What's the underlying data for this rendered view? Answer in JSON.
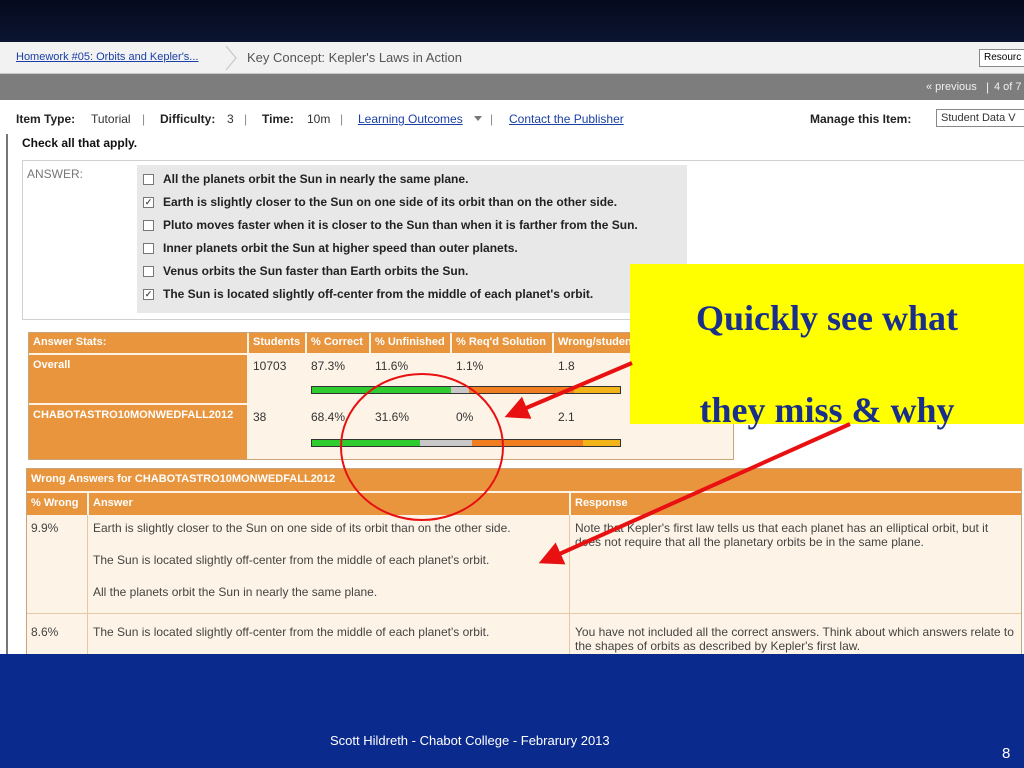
{
  "breadcrumb": {
    "link": "Homework #05: Orbits and Kepler's...",
    "current": "Key Concept: Kepler's Laws in Action"
  },
  "resources_select": "Resourc",
  "pager": {
    "previous": "« previous",
    "separator": "|",
    "count": "4 of 7"
  },
  "infobar": {
    "item_type_label": "Item Type:",
    "item_type_value": "Tutorial",
    "difficulty_label": "Difficulty:",
    "difficulty_value": "3",
    "time_label": "Time:",
    "time_value": "10m",
    "learning_outcomes": "Learning Outcomes",
    "contact": "Contact the Publisher",
    "manage_label": "Manage this Item:",
    "manage_value": "Student Data V",
    "separator": "|"
  },
  "question": {
    "instruction": "Check all that apply.",
    "answer_label": "ANSWER:",
    "options": [
      {
        "text": "All the planets orbit the Sun in nearly the same plane.",
        "checked": false,
        "mark": ""
      },
      {
        "text": "Earth is slightly closer to the Sun on one side of its orbit than on the other side.",
        "checked": true,
        "mark": "✓"
      },
      {
        "text": "Pluto moves faster when it is closer to the Sun than when it is farther from the Sun.",
        "checked": false,
        "mark": ""
      },
      {
        "text": "Inner planets orbit the Sun at higher speed than outer planets.",
        "checked": false,
        "mark": ""
      },
      {
        "text": "Venus orbits the Sun faster than Earth orbits the Sun.",
        "checked": false,
        "mark": ""
      },
      {
        "text": "The Sun is located slightly off-center from the middle of each planet's orbit.",
        "checked": true,
        "mark": "✓"
      }
    ]
  },
  "answer_stats": {
    "headers": [
      "Answer Stats:",
      "Students",
      "% Correct",
      "% Unfinished",
      "% Req'd Solution",
      "Wrong/studen"
    ],
    "rows": [
      {
        "label": "Overall",
        "students": "10703",
        "correct": "87.3%",
        "unfinished": "11.6%",
        "reqd": "1.1%",
        "wrong": "1.8",
        "bar": {
          "green": 0.45,
          "grey": 0.06,
          "orange": 0.34,
          "yellow": 0.15
        }
      },
      {
        "label": "CHABOTASTRO10MONWEDFALL2012",
        "students": "38",
        "correct": "68.4%",
        "unfinished": "31.6%",
        "reqd": "0%",
        "wrong": "2.1",
        "bar": {
          "green": 0.35,
          "grey": 0.17,
          "orange": 0.36,
          "yellow": 0.12
        }
      }
    ],
    "colors": {
      "green": "#2ecc2e",
      "grey": "#c8c8c8",
      "orange": "#f07d20",
      "yellow": "#f2b418"
    }
  },
  "wrong_answers": {
    "title": "Wrong Answers for CHABOTASTRO10MONWEDFALL2012",
    "headers": {
      "pct": "% Wrong",
      "answer": "Answer",
      "response": "Response"
    },
    "rows": [
      {
        "pct": "9.9%",
        "answers": [
          "Earth is slightly closer to the Sun on one side of its orbit than on the other side.",
          "The Sun is located slightly off-center from the middle of each planet's orbit.",
          "All the planets orbit the Sun in nearly the same plane."
        ],
        "response": "Note that Kepler's first law tells us that each planet has an elliptical orbit, but it does not require that all the planetary orbits be in the same plane."
      },
      {
        "pct": "8.6%",
        "answers": [
          "The Sun is located slightly off-center from the middle of each planet's orbit."
        ],
        "response": "You have not included all the correct answers. Think about which answers relate to the shapes of orbits as described by Kepler's first law."
      }
    ]
  },
  "callout": {
    "line1": "Quickly see what",
    "line2": "they miss & why",
    "bg": "#ffff00",
    "text_color": "#1a2f8a"
  },
  "annotation_color": "#e81010",
  "footer": {
    "credit": "Scott Hildreth - Chabot College - Febrarury 2013",
    "slide_number": "8"
  }
}
